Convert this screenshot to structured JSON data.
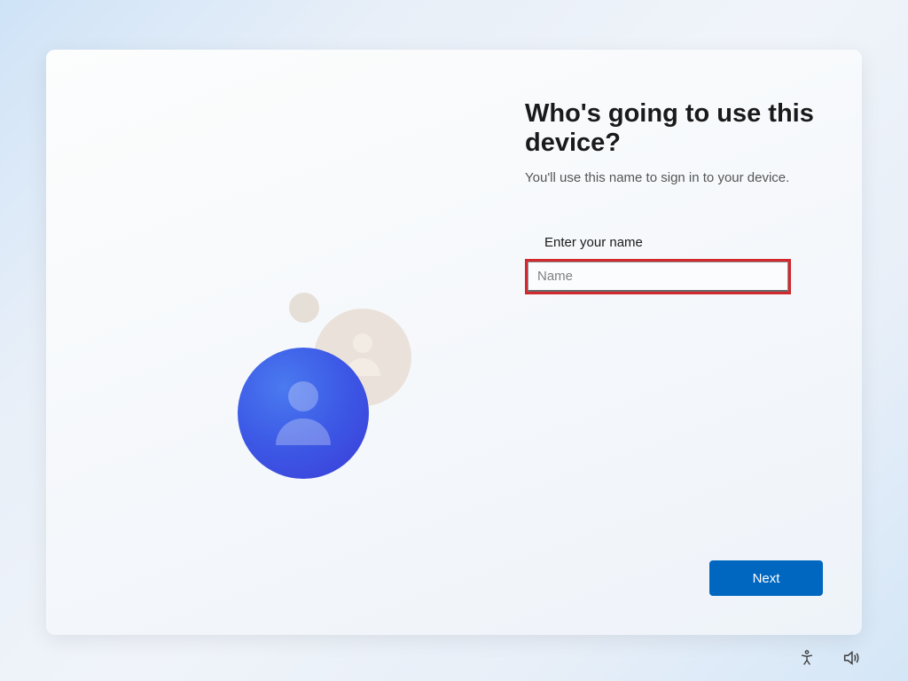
{
  "page": {
    "title": "Who's going to use this device?",
    "subtitle": "You'll use this name to sign in to your device."
  },
  "form": {
    "name_label": "Enter your name",
    "name_placeholder": "Name",
    "name_value": ""
  },
  "actions": {
    "next_label": "Next"
  },
  "taskbar": {
    "accessibility_icon": "accessibility",
    "volume_icon": "volume"
  },
  "colors": {
    "accent": "#0067c0",
    "highlight_border": "#d1292d"
  }
}
